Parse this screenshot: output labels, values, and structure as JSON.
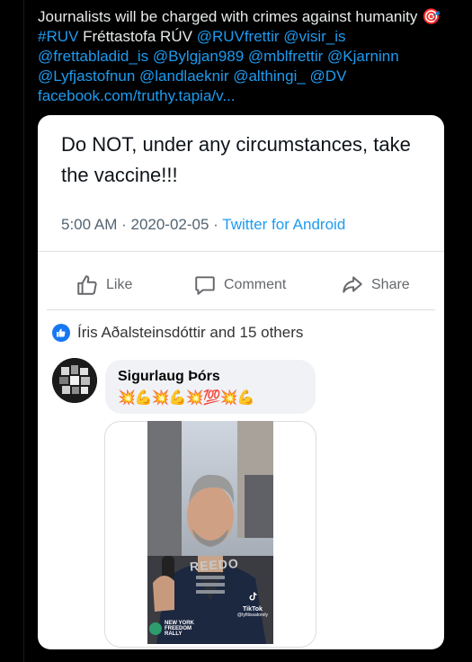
{
  "tweet": {
    "text_plain_1": "Journalists will be charged with crimes against humanity ",
    "target_emoji": "🎯",
    "hashtag": "#RUV",
    "after_hashtag": " Fréttastofa RÚV ",
    "mentions": "@RUVfrettir @visir_is @frettabladid_is @Bylgjan989 @mblfrettir @Kjarninn @Lyfjastofnun @landlaeknir @althingi_ @DV",
    "link": "facebook.com/truthy.tapia/v..."
  },
  "quoted_tweet": {
    "message": "Do NOT, under any circumstances, take the vaccine!!!",
    "time": "5:00 AM",
    "separator": " · ",
    "date": "2020-02-05",
    "source": "Twitter for Android"
  },
  "facebook": {
    "actions": {
      "like": "Like",
      "comment": "Comment",
      "share": "Share"
    },
    "reactions_text": "Íris Aðalsteinsdóttir and 15 others",
    "comment": {
      "author": "Sigurlaug Þórs",
      "emojis": "💥💪💥💪💥💯💥💪"
    },
    "video": {
      "shirt_text": "REEDO",
      "tiktok_label": "TikTok",
      "tiktok_handle": "@tyfitissatorely",
      "rally_line1": "NEW YORK",
      "rally_line2": "FREEDOM",
      "rally_line3": "RALLY"
    }
  },
  "colors": {
    "accent": "#1d9bf0",
    "facebook_blue": "#1877f2",
    "background": "#000000"
  }
}
